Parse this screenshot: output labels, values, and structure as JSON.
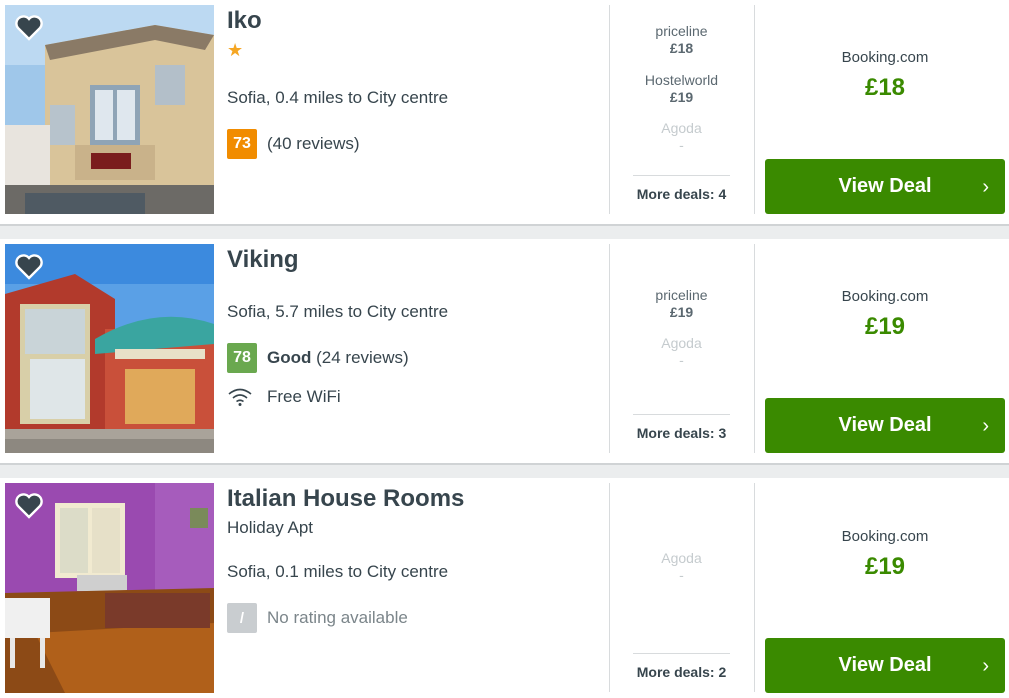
{
  "hotels": [
    {
      "name": "Iko",
      "subtype": "",
      "stars": "★",
      "location": "Sofia, 0.4 miles to City centre",
      "rating": {
        "score": "73",
        "label": "",
        "reviews": "(40 reviews)",
        "color": "#f18c00"
      },
      "amenity": "",
      "other_deals": [
        {
          "provider": "priceline",
          "price": "£18",
          "dim": false
        },
        {
          "provider": "Hostelworld",
          "price": "£19",
          "dim": false
        },
        {
          "provider": "Agoda",
          "price": "-",
          "dim": true
        }
      ],
      "more_deals": "More deals: 4",
      "best_provider": "Booking.com",
      "best_price": "£18",
      "deal_label": "View Deal",
      "photo_icon": "hotel-building-photo"
    },
    {
      "name": "Viking",
      "subtype": "",
      "stars": "",
      "location": "Sofia, 5.7 miles to City centre",
      "rating": {
        "score": "78",
        "label": "Good",
        "reviews": "(24 reviews)",
        "color": "#6aa84f"
      },
      "amenity": "Free WiFi",
      "other_deals": [
        {
          "provider": "priceline",
          "price": "£19",
          "dim": false
        },
        {
          "provider": "Agoda",
          "price": "-",
          "dim": true
        }
      ],
      "more_deals": "More deals: 3",
      "best_provider": "Booking.com",
      "best_price": "£19",
      "deal_label": "View Deal",
      "photo_icon": "hotel-building-photo"
    },
    {
      "name": "Italian House Rooms",
      "subtype": "Holiday Apt",
      "stars": "",
      "location": "Sofia, 0.1 miles to City centre",
      "rating": {
        "score": "/",
        "label": "",
        "reviews": "No rating available",
        "color": "#c9cdd0"
      },
      "amenity": "",
      "other_deals": [
        {
          "provider": "Agoda",
          "price": "-",
          "dim": true
        }
      ],
      "more_deals": "More deals: 2",
      "best_provider": "Booking.com",
      "best_price": "£19",
      "deal_label": "View Deal",
      "photo_icon": "room-interior-photo"
    }
  ],
  "icons": {
    "favorite": "heart-icon",
    "wifi": "wifi-icon",
    "next": "chevron-right-icon"
  },
  "colors": {
    "deal_green": "#3a8a00",
    "score_orange": "#f18c00",
    "score_green": "#6aa84f"
  }
}
